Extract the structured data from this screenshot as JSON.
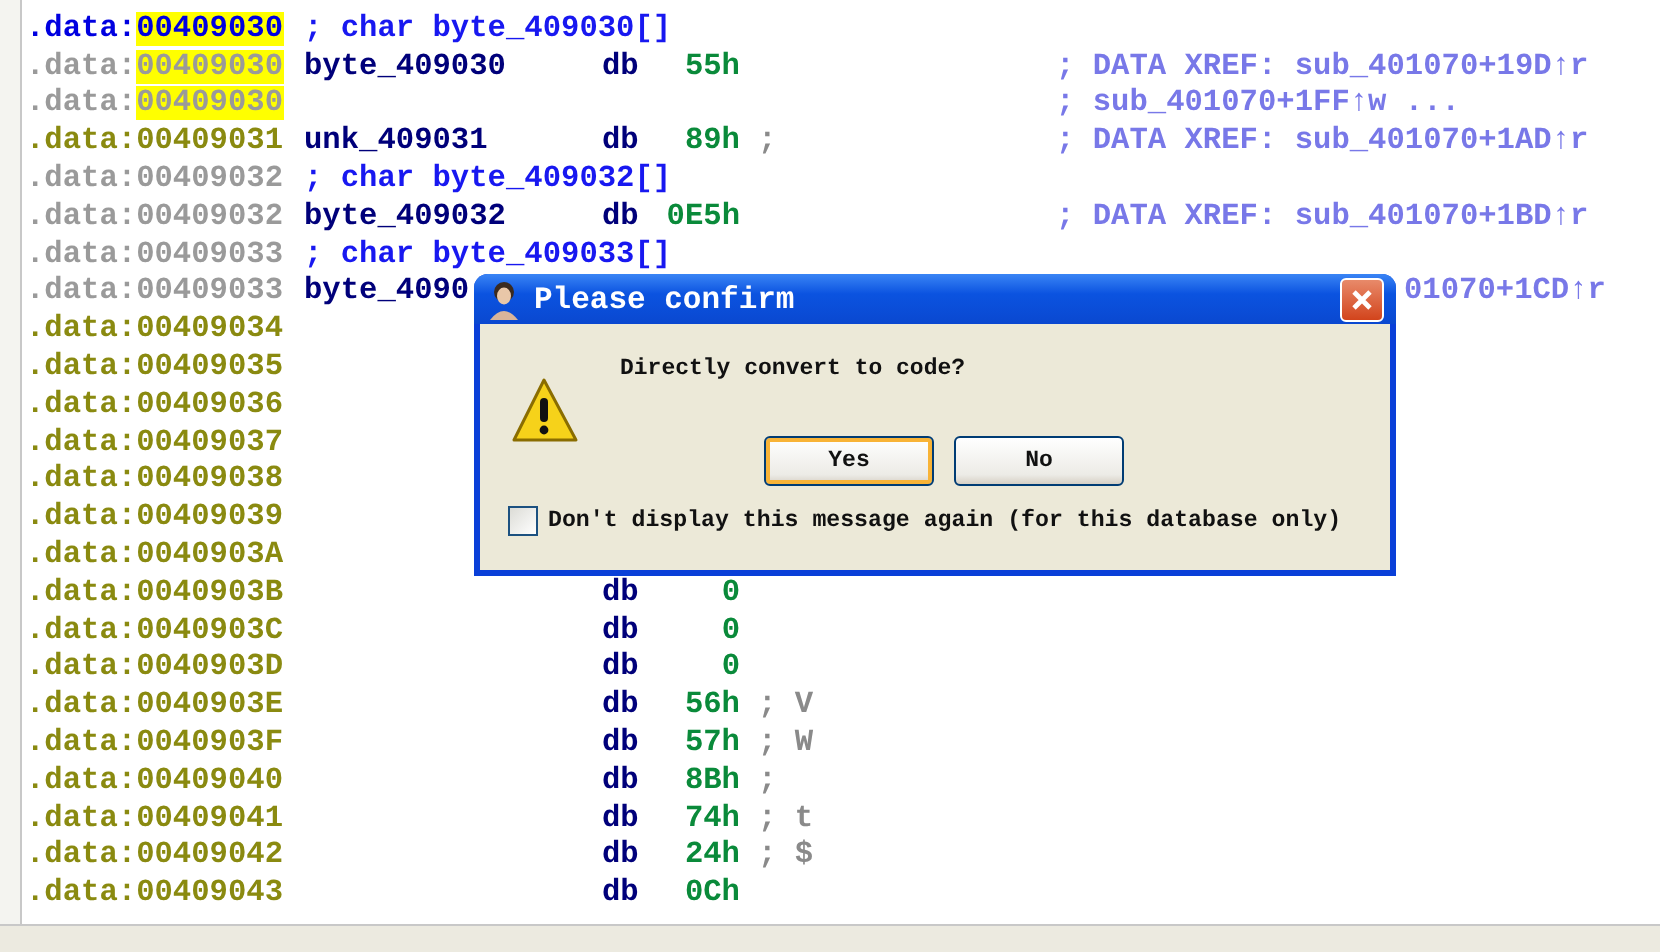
{
  "listing": [
    {
      "prefix": ".data:",
      "address": "00409030",
      "color": "#0000e0",
      "highlighted": true,
      "comment_text": "; char byte_409030[]"
    },
    {
      "prefix": ".data:",
      "address": "00409030",
      "color": "#9a9a9a",
      "highlighted": true,
      "label": "byte_409030",
      "directive": "db",
      "operand": "55h",
      "xref": "; DATA XREF: sub_401070+19D↑r"
    },
    {
      "prefix": ".data:",
      "address": "00409030",
      "color": "#9a9a9a",
      "highlighted": true,
      "xref": "; sub_401070+1FF↑w ..."
    },
    {
      "prefix": ".data:",
      "address": "00409031",
      "color": "#8a8a10",
      "highlighted": false,
      "label": "unk_409031",
      "directive": "db",
      "operand": "89h",
      "comment": ";",
      "xref": "; DATA XREF: sub_401070+1AD↑r"
    },
    {
      "prefix": ".data:",
      "address": "00409032",
      "color": "#9a9a9a",
      "highlighted": false,
      "comment_text": "; char byte_409032[]"
    },
    {
      "prefix": ".data:",
      "address": "00409032",
      "color": "#9a9a9a",
      "highlighted": false,
      "label": "byte_409032",
      "directive": "db",
      "operand": "0E5h",
      "xref": "; DATA XREF: sub_401070+1BD↑r"
    },
    {
      "prefix": ".data:",
      "address": "00409033",
      "color": "#9a9a9a",
      "highlighted": false,
      "comment_text": "; char byte_409033[]"
    },
    {
      "prefix": ".data:",
      "address": "00409033",
      "color": "#9a9a9a",
      "highlighted": false,
      "label": "byte_4090",
      "xref_tail": "01070+1CD↑r"
    },
    {
      "prefix": ".data:",
      "address": "00409034",
      "color": "#8a8a10",
      "highlighted": false
    },
    {
      "prefix": ".data:",
      "address": "00409035",
      "color": "#8a8a10",
      "highlighted": false
    },
    {
      "prefix": ".data:",
      "address": "00409036",
      "color": "#8a8a10",
      "highlighted": false
    },
    {
      "prefix": ".data:",
      "address": "00409037",
      "color": "#8a8a10",
      "highlighted": false
    },
    {
      "prefix": ".data:",
      "address": "00409038",
      "color": "#8a8a10",
      "highlighted": false
    },
    {
      "prefix": ".data:",
      "address": "00409039",
      "color": "#8a8a10",
      "highlighted": false
    },
    {
      "prefix": ".data:",
      "address": "0040903A",
      "color": "#8a8a10",
      "highlighted": false
    },
    {
      "prefix": ".data:",
      "address": "0040903B",
      "color": "#8a8a10",
      "highlighted": false,
      "directive": "db",
      "operand": "0"
    },
    {
      "prefix": ".data:",
      "address": "0040903C",
      "color": "#8a8a10",
      "highlighted": false,
      "directive": "db",
      "operand": "0"
    },
    {
      "prefix": ".data:",
      "address": "0040903D",
      "color": "#8a8a10",
      "highlighted": false,
      "directive": "db",
      "operand": "0"
    },
    {
      "prefix": ".data:",
      "address": "0040903E",
      "color": "#8a8a10",
      "highlighted": false,
      "directive": "db",
      "operand": "56h",
      "comment": "; V"
    },
    {
      "prefix": ".data:",
      "address": "0040903F",
      "color": "#8a8a10",
      "highlighted": false,
      "directive": "db",
      "operand": "57h",
      "comment": "; W"
    },
    {
      "prefix": ".data:",
      "address": "00409040",
      "color": "#8a8a10",
      "highlighted": false,
      "directive": "db",
      "operand": "8Bh",
      "comment": ";"
    },
    {
      "prefix": ".data:",
      "address": "00409041",
      "color": "#8a8a10",
      "highlighted": false,
      "directive": "db",
      "operand": "74h",
      "comment": "; t"
    },
    {
      "prefix": ".data:",
      "address": "00409042",
      "color": "#8a8a10",
      "highlighted": false,
      "directive": "db",
      "operand": "24h",
      "comment": "; $"
    },
    {
      "prefix": ".data:",
      "address": "00409043",
      "color": "#8a8a10",
      "highlighted": false,
      "directive": "db",
      "operand": "0Ch"
    }
  ],
  "dialog": {
    "title": "Please confirm",
    "message": "Directly convert to code?",
    "buttons": [
      {
        "label": "Yes",
        "focused": true
      },
      {
        "label": "No",
        "focused": false
      }
    ],
    "checkbox": {
      "label": "Don't display this message again (for this database only)",
      "checked": false
    }
  }
}
